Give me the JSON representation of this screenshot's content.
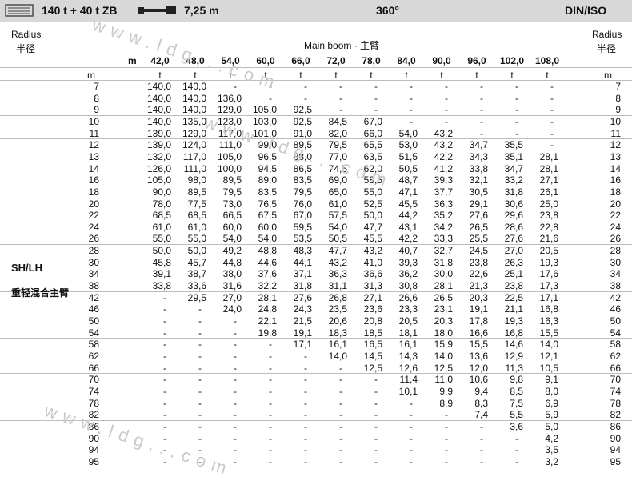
{
  "header": {
    "capacity": "140 t + 40 t ZB",
    "boom_length": "7,25 m",
    "rotation": "360°",
    "standard": "DIN/ISO"
  },
  "labels": {
    "radius_en": "Radius",
    "radius_cn": "半径",
    "main_boom": "Main boom · 主臂",
    "m": "m",
    "mode": "SH/LH",
    "mode_cn": "重轻混合主臂",
    "watermark": "www.ldg...com"
  },
  "columns": [
    "42,0",
    "48,0",
    "54,0",
    "60,0",
    "66,0",
    "72,0",
    "78,0",
    "84,0",
    "90,0",
    "96,0",
    "102,0",
    "108,0"
  ],
  "units": {
    "left": "m",
    "cell": "t",
    "right": "m"
  },
  "rows": [
    {
      "r": "7",
      "v": [
        "140,0",
        "140,0",
        "-",
        "-",
        "-",
        "-",
        "-",
        "-",
        "-",
        "-",
        "-",
        "-"
      ]
    },
    {
      "r": "8",
      "v": [
        "140,0",
        "140,0",
        "136,0",
        "-",
        "-",
        "-",
        "-",
        "-",
        "-",
        "-",
        "-",
        "-"
      ]
    },
    {
      "r": "9",
      "v": [
        "140,0",
        "140,0",
        "129,0",
        "105,0",
        "92,5",
        "-",
        "-",
        "-",
        "-",
        "-",
        "-",
        "-"
      ]
    },
    {
      "r": "10",
      "v": [
        "140,0",
        "135,0",
        "123,0",
        "103,0",
        "92,5",
        "84,5",
        "67,0",
        "-",
        "-",
        "-",
        "-",
        "-"
      ]
    },
    {
      "r": "11",
      "v": [
        "139,0",
        "129,0",
        "117,0",
        "101,0",
        "91,0",
        "82,0",
        "66,0",
        "54,0",
        "43,2",
        "-",
        "-",
        "-"
      ]
    },
    {
      "r": "12",
      "v": [
        "139,0",
        "124,0",
        "111,0",
        "99,0",
        "89,5",
        "79,5",
        "65,5",
        "53,0",
        "43,2",
        "34,7",
        "35,5",
        "-"
      ]
    },
    {
      "r": "13",
      "v": [
        "132,0",
        "117,0",
        "105,0",
        "96,5",
        "88,0",
        "77,0",
        "63,5",
        "51,5",
        "42,2",
        "34,3",
        "35,1",
        "28,1"
      ]
    },
    {
      "r": "14",
      "v": [
        "126,0",
        "111,0",
        "100,0",
        "94,5",
        "86,5",
        "74,5",
        "62,0",
        "50,5",
        "41,2",
        "33,8",
        "34,7",
        "28,1"
      ]
    },
    {
      "r": "16",
      "v": [
        "105,0",
        "98,0",
        "89,5",
        "89,0",
        "83,5",
        "69,0",
        "58,5",
        "48,7",
        "39,3",
        "32,1",
        "33,2",
        "27,1"
      ]
    },
    {
      "r": "18",
      "v": [
        "90,0",
        "89,5",
        "79,5",
        "83,5",
        "79,5",
        "65,0",
        "55,0",
        "47,1",
        "37,7",
        "30,5",
        "31,8",
        "26,1"
      ]
    },
    {
      "r": "20",
      "v": [
        "78,0",
        "77,5",
        "73,0",
        "76,5",
        "76,0",
        "61,0",
        "52,5",
        "45,5",
        "36,3",
        "29,1",
        "30,6",
        "25,0"
      ]
    },
    {
      "r": "22",
      "v": [
        "68,5",
        "68,5",
        "66,5",
        "67,5",
        "67,0",
        "57,5",
        "50,0",
        "44,2",
        "35,2",
        "27,6",
        "29,6",
        "23,8"
      ]
    },
    {
      "r": "24",
      "v": [
        "61,0",
        "61,0",
        "60,0",
        "60,0",
        "59,5",
        "54,0",
        "47,7",
        "43,1",
        "34,2",
        "26,5",
        "28,6",
        "22,8"
      ]
    },
    {
      "r": "26",
      "v": [
        "55,0",
        "55,0",
        "54,0",
        "54,0",
        "53,5",
        "50,5",
        "45,5",
        "42,2",
        "33,3",
        "25,5",
        "27,6",
        "21,6"
      ]
    },
    {
      "r": "28",
      "v": [
        "50,0",
        "50,0",
        "49,2",
        "48,8",
        "48,3",
        "47,7",
        "43,2",
        "40,7",
        "32,7",
        "24,5",
        "27,0",
        "20,5"
      ]
    },
    {
      "r": "30",
      "v": [
        "45,8",
        "45,7",
        "44,8",
        "44,6",
        "44,1",
        "43,2",
        "41,0",
        "39,3",
        "31,8",
        "23,8",
        "26,3",
        "19,3"
      ]
    },
    {
      "r": "34",
      "v": [
        "39,1",
        "38,7",
        "38,0",
        "37,6",
        "37,1",
        "36,3",
        "36,6",
        "36,2",
        "30,0",
        "22,6",
        "25,1",
        "17,6"
      ]
    },
    {
      "r": "38",
      "v": [
        "33,8",
        "33,6",
        "31,6",
        "32,2",
        "31,8",
        "31,1",
        "31,3",
        "30,8",
        "28,1",
        "21,3",
        "23,8",
        "17,3"
      ]
    },
    {
      "r": "42",
      "v": [
        "-",
        "29,5",
        "27,0",
        "28,1",
        "27,6",
        "26,8",
        "27,1",
        "26,6",
        "26,5",
        "20,3",
        "22,5",
        "17,1"
      ]
    },
    {
      "r": "46",
      "v": [
        "-",
        "-",
        "24,0",
        "24,8",
        "24,3",
        "23,5",
        "23,6",
        "23,3",
        "23,1",
        "19,1",
        "21,1",
        "16,8"
      ]
    },
    {
      "r": "50",
      "v": [
        "-",
        "-",
        "-",
        "22,1",
        "21,5",
        "20,6",
        "20,8",
        "20,5",
        "20,3",
        "17,8",
        "19,3",
        "16,3"
      ]
    },
    {
      "r": "54",
      "v": [
        "-",
        "-",
        "-",
        "19,8",
        "19,1",
        "18,3",
        "18,5",
        "18,1",
        "18,0",
        "16,6",
        "16,8",
        "15,5"
      ]
    },
    {
      "r": "58",
      "v": [
        "-",
        "-",
        "-",
        "-",
        "17,1",
        "16,1",
        "16,5",
        "16,1",
        "15,9",
        "15,5",
        "14,6",
        "14,0"
      ]
    },
    {
      "r": "62",
      "v": [
        "-",
        "-",
        "-",
        "-",
        "-",
        "14,0",
        "14,5",
        "14,3",
        "14,0",
        "13,6",
        "12,9",
        "12,1"
      ]
    },
    {
      "r": "66",
      "v": [
        "-",
        "-",
        "-",
        "-",
        "-",
        "-",
        "12,5",
        "12,6",
        "12,5",
        "12,0",
        "11,3",
        "10,5"
      ]
    },
    {
      "r": "70",
      "v": [
        "-",
        "-",
        "-",
        "-",
        "-",
        "-",
        "-",
        "11,4",
        "11,0",
        "10,6",
        "9,8",
        "9,1"
      ]
    },
    {
      "r": "74",
      "v": [
        "-",
        "-",
        "-",
        "-",
        "-",
        "-",
        "-",
        "10,1",
        "9,9",
        "9,4",
        "8,5",
        "8,0"
      ]
    },
    {
      "r": "78",
      "v": [
        "-",
        "-",
        "-",
        "-",
        "-",
        "-",
        "-",
        "-",
        "8,9",
        "8,3",
        "7,5",
        "6,9"
      ]
    },
    {
      "r": "82",
      "v": [
        "-",
        "-",
        "-",
        "-",
        "-",
        "-",
        "-",
        "-",
        "-",
        "7,4",
        "5,5",
        "5,9"
      ]
    },
    {
      "r": "86",
      "v": [
        "-",
        "-",
        "-",
        "-",
        "-",
        "-",
        "-",
        "-",
        "-",
        "-",
        "3,6",
        "5,0"
      ]
    },
    {
      "r": "90",
      "v": [
        "-",
        "-",
        "-",
        "-",
        "-",
        "-",
        "-",
        "-",
        "-",
        "-",
        "-",
        "4,2"
      ]
    },
    {
      "r": "94",
      "v": [
        "-",
        "-",
        "-",
        "-",
        "-",
        "-",
        "-",
        "-",
        "-",
        "-",
        "-",
        "3,5"
      ]
    },
    {
      "r": "95",
      "v": [
        "-",
        "-",
        "-",
        "-",
        "-",
        "-",
        "-",
        "-",
        "-",
        "-",
        "-",
        "3,2"
      ]
    }
  ]
}
